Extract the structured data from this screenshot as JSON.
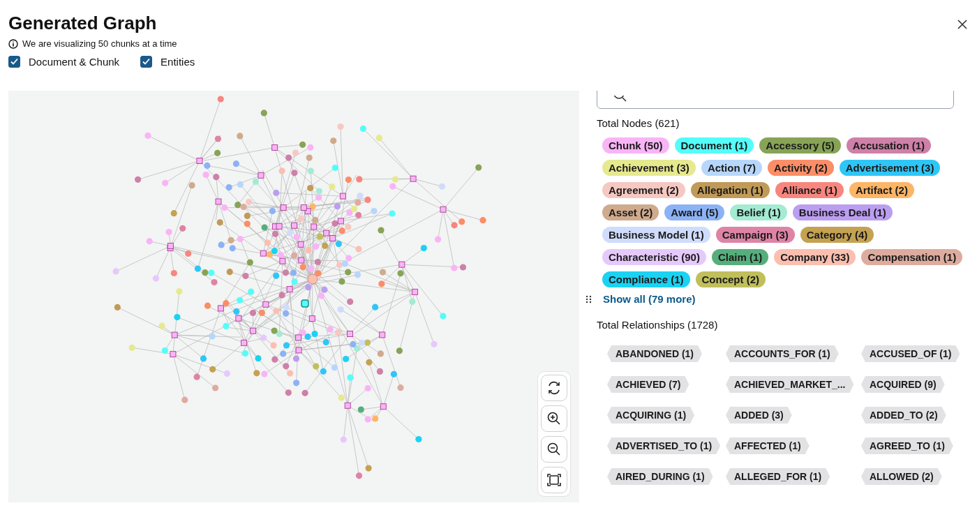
{
  "dialog": {
    "title": "Generated Graph",
    "info": "We are visualizing 50 chunks at a time"
  },
  "filters": [
    {
      "label": "Document & Chunk",
      "checked": true
    },
    {
      "label": "Entities",
      "checked": true
    }
  ],
  "node_types": {
    "title": "Total Nodes (621)",
    "items": [
      {
        "label": "Chunk (50)",
        "color": "#f9b4f6"
      },
      {
        "label": "Document (1)",
        "color": "#54fdf9"
      },
      {
        "label": "Accessory (5)",
        "color": "#87a456"
      },
      {
        "label": "Accusation (1)",
        "color": "#ce80a8"
      },
      {
        "label": "Achievement (3)",
        "color": "#e6e98e"
      },
      {
        "label": "Action (7)",
        "color": "#b6d7fb"
      },
      {
        "label": "Activity (2)",
        "color": "#fb8d67"
      },
      {
        "label": "Advertisement (3)",
        "color": "#2ec6f7"
      },
      {
        "label": "Agreement (2)",
        "color": "#f6c8c2"
      },
      {
        "label": "Allegation (1)",
        "color": "#c19a58"
      },
      {
        "label": "Alliance (1)",
        "color": "#f8867f"
      },
      {
        "label": "Artifact (2)",
        "color": "#fdb567"
      },
      {
        "label": "Asset (2)",
        "color": "#cfaa8d"
      },
      {
        "label": "Award (5)",
        "color": "#8cb2f6"
      },
      {
        "label": "Belief (1)",
        "color": "#a3ebd2"
      },
      {
        "label": "Business Deal (1)",
        "color": "#bb9ef0"
      },
      {
        "label": "Business Model (1)",
        "color": "#cfdcfb"
      },
      {
        "label": "Campaign (3)",
        "color": "#dd84a6"
      },
      {
        "label": "Category (4)",
        "color": "#c4a252"
      },
      {
        "label": "Characteristic (90)",
        "color": "#e6c9fb"
      },
      {
        "label": "Claim (1)",
        "color": "#56ae7c"
      },
      {
        "label": "Company (33)",
        "color": "#fbbfb0"
      },
      {
        "label": "Compensation (1)",
        "color": "#ddac9f"
      },
      {
        "label": "Compliance (1)",
        "color": "#1cd2f2"
      },
      {
        "label": "Concept (2)",
        "color": "#c0bf5b"
      }
    ],
    "show_all": "Show all (79 more)"
  },
  "relationship_types": {
    "title": "Total Relationships (1728)",
    "items": [
      "ABANDONED (1)",
      "ACCOUNTS_FOR (1)",
      "ACCUSED_OF (1)",
      "ACHIEVED (7)",
      "ACHIEVED_MARKET_...",
      "ACQUIRED (9)",
      "ACQUIRING (1)",
      "ADDED (3)",
      "ADDED_TO (2)",
      "ADVERTISED_TO (1)",
      "AFFECTED (1)",
      "AGREED_TO (1)",
      "AIRED_DURING (1)",
      "ALLEGED_FOR (1)",
      "ALLOWED (2)"
    ]
  }
}
